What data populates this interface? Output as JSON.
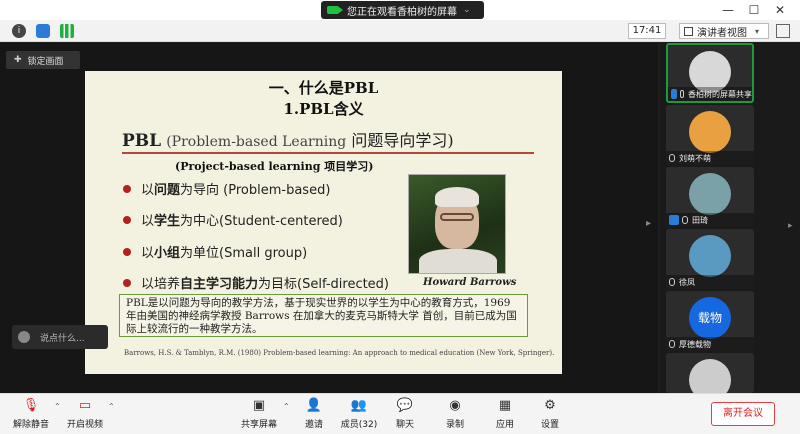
{
  "window": {
    "share_banner": "您正在观看香柏树的屏幕",
    "minimize": "—",
    "maximize": "☐",
    "close": "✕"
  },
  "infobar": {
    "time": "17:41",
    "view_label": "演讲者视图"
  },
  "stage": {
    "lock_label": "锁定画面",
    "chat_placeholder": "说点什么..."
  },
  "slide": {
    "title_line1": "一、什么是PBL",
    "title_line2": "1.PBL含义",
    "heading_bold": "PBL",
    "heading_en": "(Problem-based Learning",
    "heading_cn": "问题导向学习)",
    "subtitle": "(Project-based learning 项目学习)",
    "bullets": [
      {
        "pre": "以",
        "bold": "问题",
        "post": "为导向 (Problem-based)"
      },
      {
        "pre": "以",
        "bold": "学生",
        "post": "为中心(Student-centered)"
      },
      {
        "pre": "以",
        "bold": "小组",
        "post": "为单位(Small group)"
      },
      {
        "pre": "以培养",
        "bold": "自主学习能力",
        "post": "为目标(Self-directed)"
      }
    ],
    "photo_caption": "Howard Barrows",
    "description": "PBL是以问题为导向的教学方法，基于现实世界的以学生为中心的教育方式，1969 年由美国的神经病学教授 Barrows 在加拿大的麦克马斯特大学 首创，目前已成为国际上较流行的一种教学方法。",
    "reference": "Barrows, H.S. & Tamblyn, R.M. (1980) Problem-based learning: An approach to medical education (New York, Springer)."
  },
  "participants": [
    {
      "name": "香柏树的屏幕共享",
      "avatar_color": "#d8d8d8",
      "active": true
    },
    {
      "name": "刘萌不萌",
      "avatar_color": "#e8a040",
      "active": false
    },
    {
      "name": "田琦",
      "avatar_color": "#7aa0a8",
      "active": false
    },
    {
      "name": "徐凤",
      "avatar_color": "#5a9ac0",
      "active": false
    },
    {
      "name": "厚德载物",
      "avatar_text": "载物",
      "avatar_color": "#1668e0",
      "active": false
    },
    {
      "name": "",
      "avatar_color": "#cccccc",
      "active": false
    }
  ],
  "toolbar": {
    "mute": "解除静音",
    "video": "开启视频",
    "share": "共享屏幕",
    "invite": "邀请",
    "members": "成员(32)",
    "chat": "聊天",
    "record": "录制",
    "apps": "应用",
    "settings": "设置",
    "leave": "离开会议"
  },
  "colors": {
    "accent_green": "#1f9a3a",
    "leave_red": "#e02020",
    "slide_rule": "#b14a3a"
  }
}
